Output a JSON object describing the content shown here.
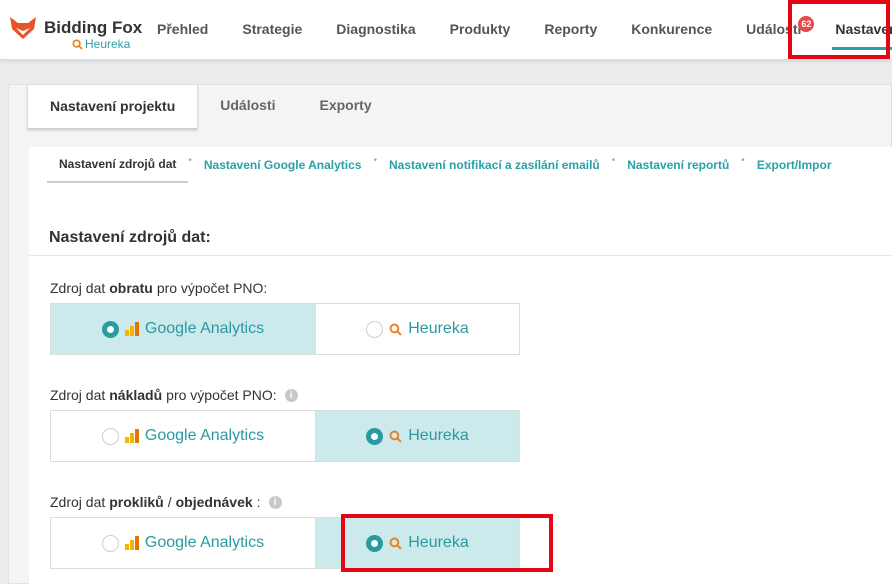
{
  "brand": {
    "name": "Bidding Fox",
    "sub": "Heureka"
  },
  "nav": {
    "items": [
      {
        "label": "Přehled"
      },
      {
        "label": "Strategie"
      },
      {
        "label": "Diagnostika"
      },
      {
        "label": "Produkty"
      },
      {
        "label": "Reporty"
      },
      {
        "label": "Konkurence"
      },
      {
        "label": "Události",
        "badge": "62"
      },
      {
        "label": "Nastavení",
        "active": true
      }
    ]
  },
  "tabs": [
    {
      "label": "Nastavení projektu",
      "active": true
    },
    {
      "label": "Události"
    },
    {
      "label": "Exporty"
    }
  ],
  "subnav": [
    {
      "label": "Nastavení zdrojů dat",
      "active": true
    },
    {
      "label": "Nastavení Google Analytics"
    },
    {
      "label": "Nastavení notifikací a zasílání emailů"
    },
    {
      "label": "Nastavení reportů"
    },
    {
      "label": "Export/Impor"
    }
  ],
  "section": {
    "title": "Nastavení zdrojů dat:"
  },
  "fields": [
    {
      "label_pre": "Zdroj dat ",
      "label_bold": "obratu",
      "label_post": " pro výpočet PNO:",
      "options": [
        "Google Analytics",
        "Heureka"
      ],
      "selected": "Google Analytics"
    },
    {
      "label_pre": "Zdroj dat ",
      "label_bold": "nákladů",
      "label_post": " pro výpočet PNO:",
      "options": [
        "Google Analytics",
        "Heureka"
      ],
      "selected": "Heureka",
      "info": true
    },
    {
      "label_pre": "Zdroj dat ",
      "label_bold": "prokliků",
      "label_mid": " / ",
      "label_bold2": "objednávek",
      "label_post": ":",
      "options": [
        "Google Analytics",
        "Heureka"
      ],
      "selected": "Heureka",
      "info": true
    }
  ],
  "icons": {
    "logo": "fox-logo-icon",
    "heureka": "heureka-icon",
    "google_analytics": "google-analytics-icon",
    "info": "info-icon"
  },
  "colors": {
    "accent": "#2ba0a8",
    "selected_bg": "#cce9ec",
    "badge": "#e84a4a",
    "highlight": "#e30613"
  }
}
